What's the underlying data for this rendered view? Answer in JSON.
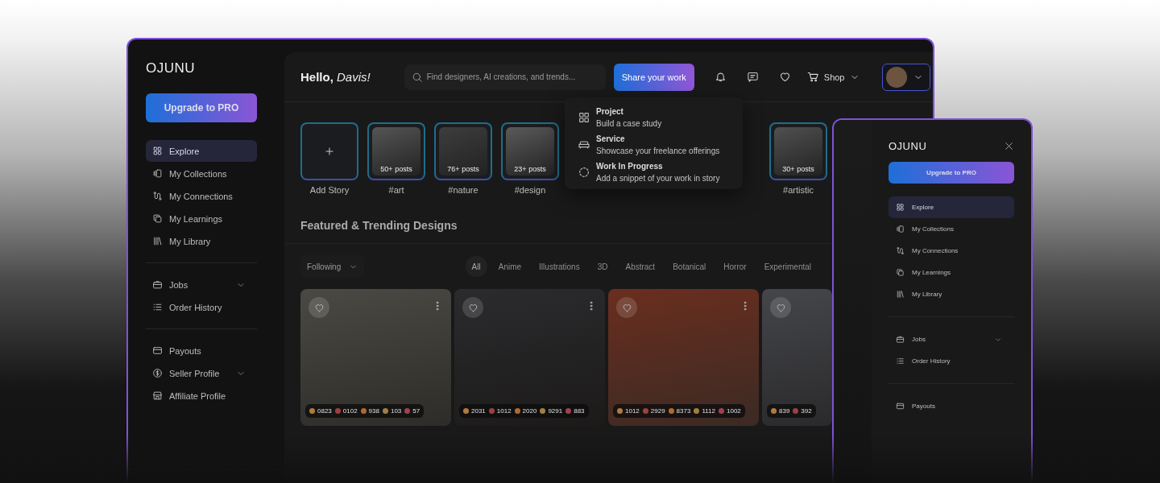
{
  "main_window": {
    "sidebar": {
      "logo": "OJUNU",
      "upgrade_button": "Upgrade to PRO",
      "groups": [
        {
          "items": [
            {
              "label": "Explore",
              "selected": true,
              "has_submenu": false
            },
            {
              "label": "My Collections",
              "selected": false,
              "has_submenu": false
            },
            {
              "label": "My Connections",
              "selected": false,
              "has_submenu": false
            },
            {
              "label": "My Learnings",
              "selected": false,
              "has_submenu": false
            },
            {
              "label": "My Library",
              "selected": false,
              "has_submenu": false
            }
          ]
        },
        {
          "items": [
            {
              "label": "Jobs",
              "selected": false,
              "has_submenu": true
            },
            {
              "label": "Order History",
              "selected": false,
              "has_submenu": false
            }
          ]
        },
        {
          "items": [
            {
              "label": "Payouts",
              "selected": false,
              "has_submenu": false
            },
            {
              "label": "Seller Profile",
              "selected": false,
              "has_submenu": true
            },
            {
              "label": "Affiliate Profile",
              "selected": false,
              "has_submenu": false
            }
          ]
        }
      ]
    },
    "topbar": {
      "greeting": "**Hello,** *Davis!*",
      "search": {
        "placeholder": "Find designers, AI creations, and trends..."
      },
      "share_button": "Share your work",
      "shop_button": "Shop"
    },
    "share_menu": {
      "items": [
        {
          "title": "Project",
          "subtitle": "Build a case study"
        },
        {
          "title": "Service",
          "subtitle": "Showcase your freelance offerings"
        },
        {
          "title": "Work In Progress",
          "subtitle": "Add a snippet of your work in story"
        }
      ]
    },
    "stories": [
      {
        "kind": "add",
        "label": "Add Story"
      },
      {
        "kind": "tag",
        "label": "#art",
        "count": "50+ posts"
      },
      {
        "kind": "tag",
        "label": "#nature",
        "count": "76+ posts"
      },
      {
        "kind": "tag",
        "label": "#design",
        "count": "23+ posts"
      },
      {
        "kind": "tag",
        "label": "#artistic",
        "count": "30+ posts"
      }
    ],
    "featured": {
      "title": "Featured & Trending Designs",
      "filter": "Following",
      "categories": [
        {
          "label": "All",
          "selected": true
        },
        {
          "label": "Anime",
          "selected": false
        },
        {
          "label": "Illustrations",
          "selected": false
        },
        {
          "label": "3D",
          "selected": false
        },
        {
          "label": "Abstract",
          "selected": false
        },
        {
          "label": "Botanical",
          "selected": false
        },
        {
          "label": "Horror",
          "selected": false
        },
        {
          "label": "Experimental",
          "selected": false
        }
      ],
      "cards": [
        {
          "stats": [
            "0823",
            "0102",
            "938",
            "103",
            "57"
          ]
        },
        {
          "stats": [
            "2031",
            "1012",
            "2020",
            "9291",
            "883"
          ]
        },
        {
          "stats": [
            "1012",
            "2929",
            "8373",
            "1112",
            "1002"
          ]
        },
        {
          "stats": [
            "839",
            "392"
          ]
        }
      ]
    }
  },
  "mobile_menu": {
    "logo": "OJUNU",
    "upgrade_button": "Upgrade to PRO",
    "groups": [
      {
        "items": [
          {
            "label": "Explore",
            "selected": true,
            "has_submenu": false
          },
          {
            "label": "My Collections",
            "selected": false,
            "has_submenu": false
          },
          {
            "label": "My Connections",
            "selected": false,
            "has_submenu": false
          },
          {
            "label": "My Learnings",
            "selected": false,
            "has_submenu": false
          },
          {
            "label": "My Library",
            "selected": false,
            "has_submenu": false
          }
        ]
      },
      {
        "items": [
          {
            "label": "Jobs",
            "selected": false,
            "has_submenu": true
          },
          {
            "label": "Order History",
            "selected": false,
            "has_submenu": false
          }
        ]
      },
      {
        "items": [
          {
            "label": "Payouts",
            "selected": false,
            "has_submenu": false
          }
        ]
      }
    ]
  }
}
